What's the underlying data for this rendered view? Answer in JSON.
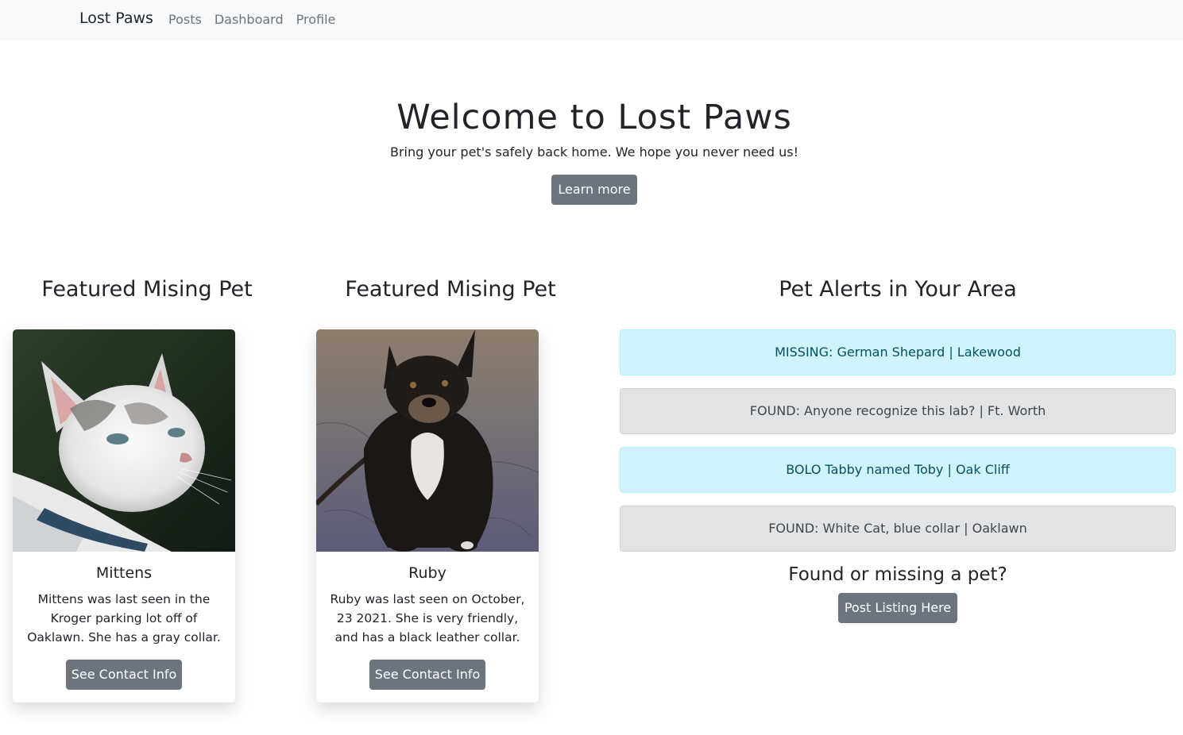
{
  "nav": {
    "brand": "Lost Paws",
    "links": [
      "Posts",
      "Dashboard",
      "Profile"
    ]
  },
  "hero": {
    "title": "Welcome to Lost Paws",
    "subtitle": "Bring your pet's safely back home. We hope you never need us!",
    "button": "Learn more"
  },
  "featured": [
    {
      "heading": "Featured Mising Pet",
      "name": "Mittens",
      "description": "Mittens was last seen in the Kroger parking lot off of Oaklawn. She has a gray collar.",
      "button": "See Contact Info",
      "image": "white-gray-cat-photo"
    },
    {
      "heading": "Featured Mising Pet",
      "name": "Ruby",
      "description": "Ruby was last seen on October, 23 2021. She is very friendly, and has a black leather collar.",
      "button": "See Contact Info",
      "image": "black-dog-photo"
    }
  ],
  "alerts": {
    "heading": "Pet Alerts in Your Area",
    "items": [
      {
        "text": "MISSING: German Shepard | Lakewood",
        "style": "info"
      },
      {
        "text": "FOUND: Anyone recognize this lab? | Ft. Worth",
        "style": "secondary"
      },
      {
        "text": "BOLO Tabby named Toby | Oak Cliff",
        "style": "info"
      },
      {
        "text": "FOUND: White Cat, blue collar | Oaklawn",
        "style": "secondary"
      }
    ],
    "cta_title": "Found or missing a pet?",
    "cta_button": "Post Listing Here"
  },
  "colors": {
    "navbar_bg": "#f8f9fa",
    "button_bg": "#6c757d",
    "alert_info_bg": "#cff4fc",
    "alert_secondary_bg": "#e2e3e5"
  }
}
